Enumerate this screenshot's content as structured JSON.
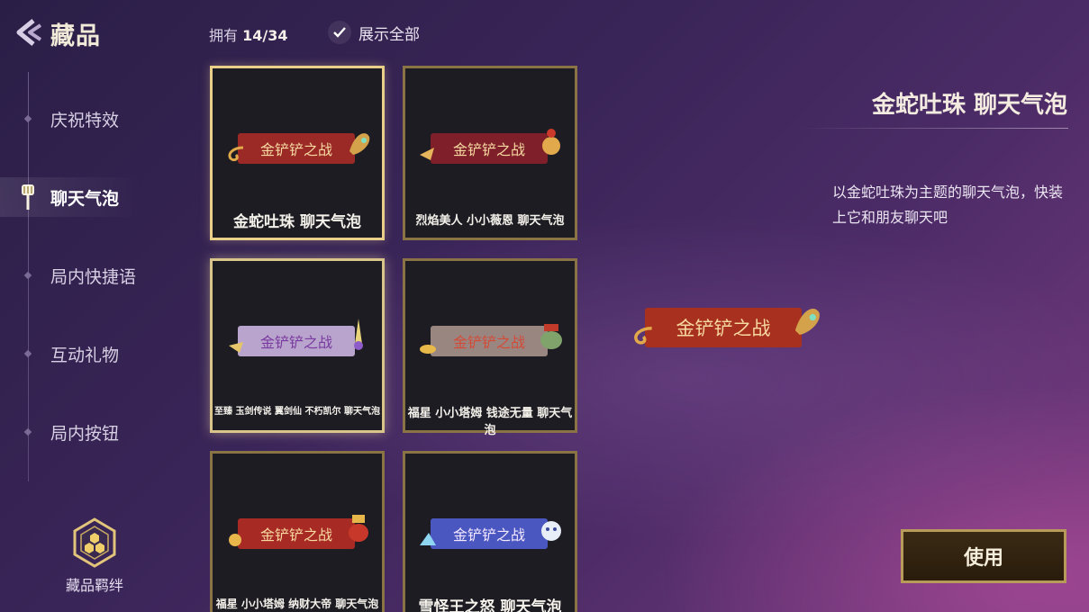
{
  "header": {
    "title": "藏品",
    "owned_label": "拥有",
    "owned_count": "14/34",
    "show_all_label": "展示全部",
    "show_all_checked": true
  },
  "sidebar": {
    "items": [
      {
        "label": "庆祝特效",
        "active": false
      },
      {
        "label": "聊天气泡",
        "active": true
      },
      {
        "label": "局内快捷语",
        "active": false
      },
      {
        "label": "互动礼物",
        "active": false
      },
      {
        "label": "局内按钮",
        "active": false
      }
    ],
    "bond_label": "藏品羁绊"
  },
  "grid": {
    "items": [
      {
        "bubble_text": "金铲铲之战",
        "name": "金蛇吐珠 聊天气泡",
        "bubble_color": "#9b2a26",
        "state": "selected"
      },
      {
        "bubble_text": "金铲铲之战",
        "name": "烈焰美人 小小薇恩 聊天气泡",
        "bubble_color": "#7e1f2a",
        "state": "normal"
      },
      {
        "bubble_text": "金铲铲之战",
        "name": "至臻 玉剑传说 翼剑仙 不朽凯尔 聊天气泡",
        "bubble_color": "#b8a4cc",
        "state": "hover"
      },
      {
        "bubble_text": "金铲铲之战",
        "name": "福星 小小塔姆 钱途无量 聊天气泡",
        "bubble_color": "#9a8680",
        "state": "normal"
      },
      {
        "bubble_text": "金铲铲之战",
        "name": "福星 小小塔姆 纳财大帝 聊天气泡",
        "bubble_color": "#a82a24",
        "state": "normal"
      },
      {
        "bubble_text": "金铲铲之战",
        "name": "雪怪王之怒 聊天气泡",
        "bubble_color": "#4a57c0",
        "state": "normal"
      }
    ]
  },
  "detail": {
    "title": "金蛇吐珠 聊天气泡",
    "description": "以金蛇吐珠为主题的聊天气泡，快装上它和朋友聊天吧",
    "preview_text": "金铲铲之战",
    "use_button": "使用"
  },
  "colors": {
    "gold_border": "#8a7446",
    "selected_border": "#e9cf8a",
    "card_bg": "#1c1c22"
  }
}
